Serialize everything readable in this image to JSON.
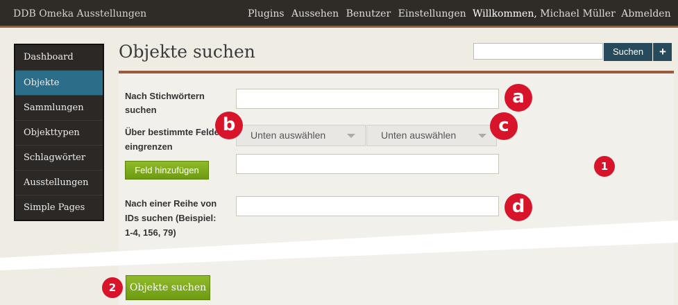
{
  "topbar": {
    "site_title": "DDB Omeka Ausstellungen",
    "nav": [
      "Plugins",
      "Aussehen",
      "Benutzer",
      "Einstellungen"
    ],
    "welcome": "Willkommen,",
    "user_name": "Michael Müller",
    "logout": "Abmelden"
  },
  "sidebar": {
    "items": [
      {
        "label": "Dashboard"
      },
      {
        "label": "Objekte"
      },
      {
        "label": "Sammlungen"
      },
      {
        "label": "Objekttypen"
      },
      {
        "label": "Schlagwörter"
      },
      {
        "label": "Ausstellungen"
      },
      {
        "label": "Simple Pages"
      }
    ]
  },
  "page": {
    "title": "Objekte suchen"
  },
  "header_search": {
    "value": "",
    "button_label": "Suchen",
    "add_label": "+"
  },
  "form": {
    "keyword_label": "Nach Stichwörtern suchen",
    "keyword_value": "",
    "fields_label_line1": "Über bestimmte Felder",
    "fields_label_line2": "eingrenzen",
    "field_select": "Unten auswählen",
    "type_select": "Unten auswählen",
    "field_value": "",
    "add_field_button": "Feld hinzufügen",
    "ids_label_line1": "Nach einer Reihe von",
    "ids_label_line2": "IDs suchen (Beispiel:",
    "ids_label_line3": "1-4, 156, 79)",
    "ids_value": "",
    "submit_button": "Objekte suchen"
  },
  "badges": {
    "a": "a",
    "b": "b",
    "c": "c",
    "d": "d",
    "one": "1",
    "two": "2"
  },
  "colors": {
    "topbar_bg": "#2f2b27",
    "accent_border": "#9b5a3c",
    "sidebar_active": "#2c6e8a",
    "search_button": "#274a5c",
    "green_button": "#7aa61a",
    "badge_red": "#d7142a"
  }
}
